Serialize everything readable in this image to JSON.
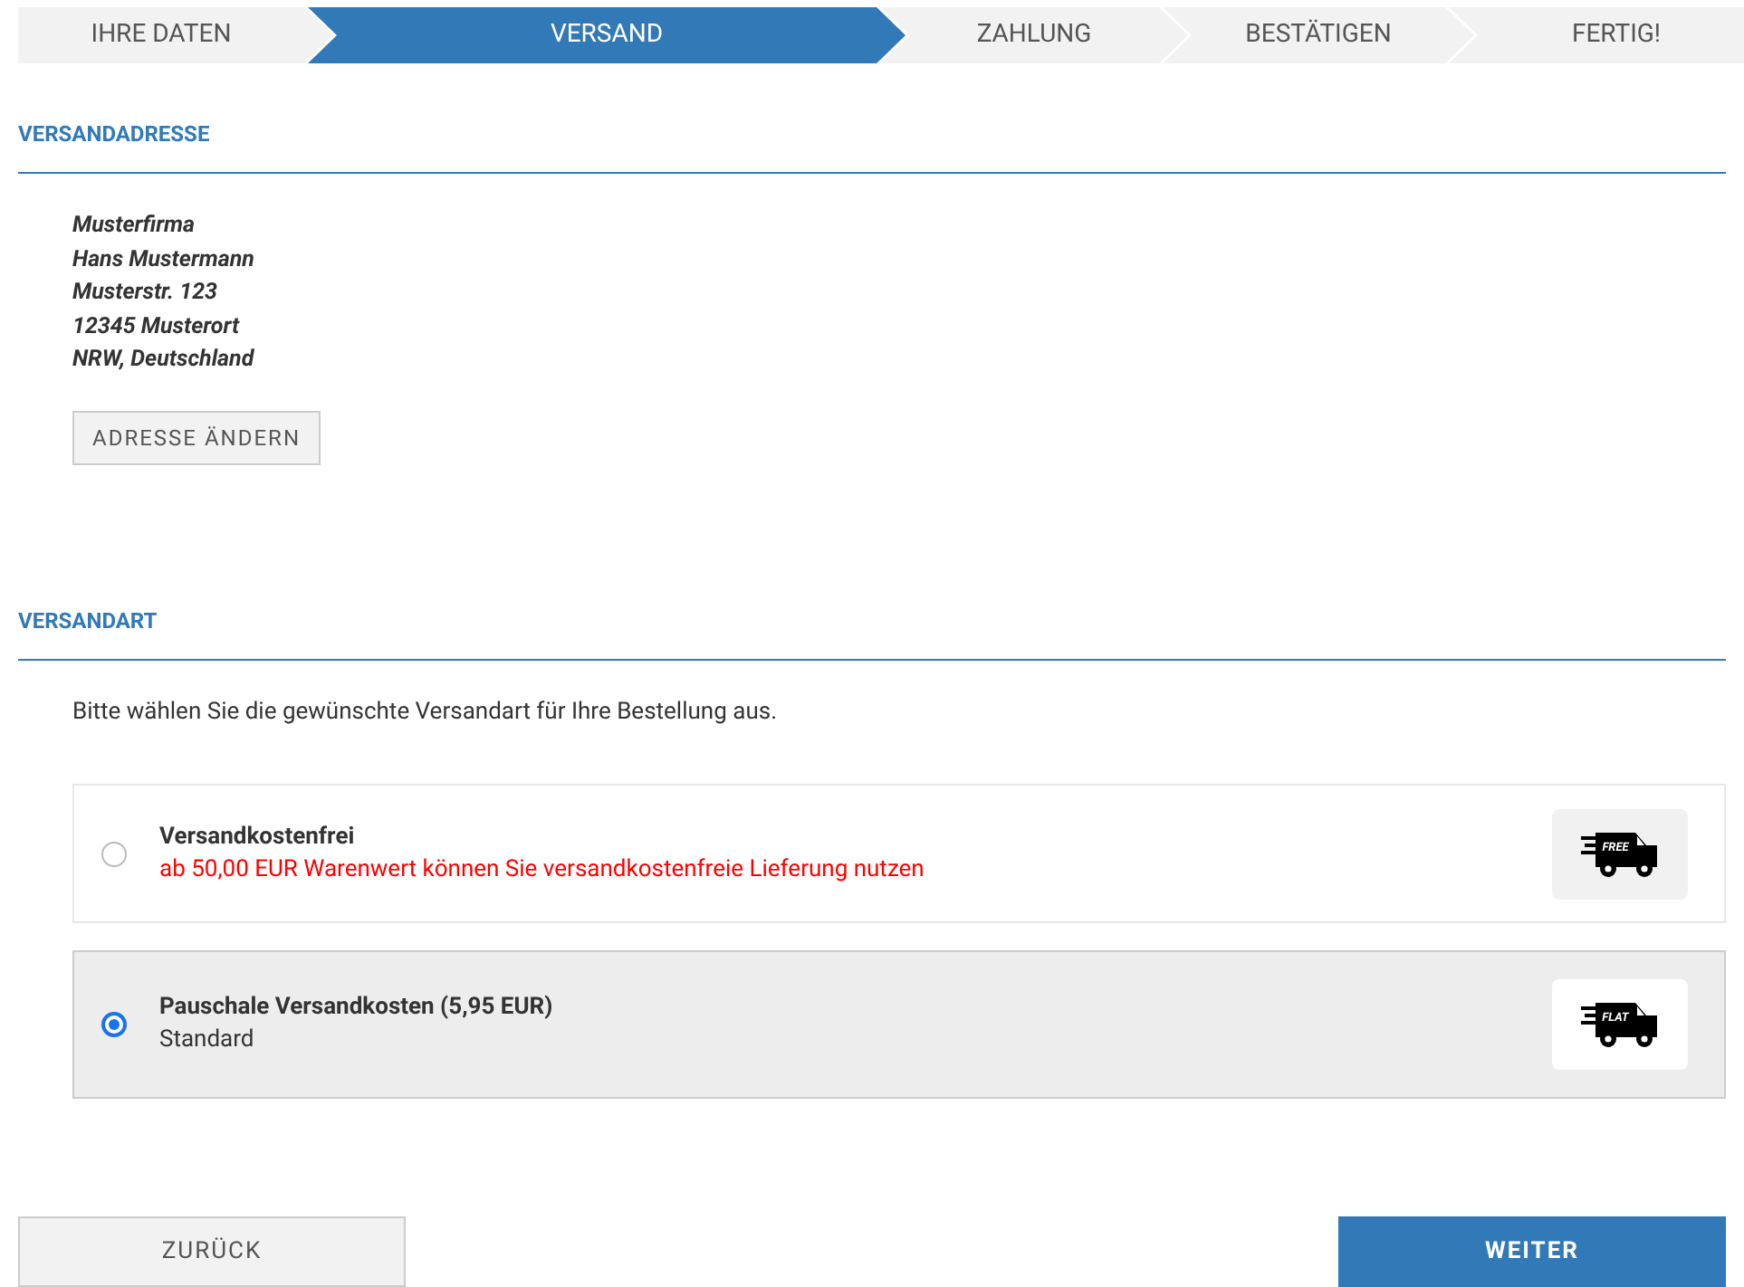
{
  "steps": [
    {
      "label": "IHRE DATEN",
      "selected": false
    },
    {
      "label": "VERSAND",
      "selected": true
    },
    {
      "label": "ZAHLUNG",
      "selected": false
    },
    {
      "label": "BESTÄTIGEN",
      "selected": false
    },
    {
      "label": "FERTIG!",
      "selected": false
    }
  ],
  "address_section": {
    "title": "VERSANDADRESSE",
    "lines": [
      "Musterfirma",
      "Hans Mustermann",
      "Musterstr. 123",
      "12345 Musterort",
      "NRW, Deutschland"
    ],
    "button": "ADRESSE ÄNDERN"
  },
  "shipping_section": {
    "title": "VERSANDART",
    "intro": "Bitte wählen Sie die gewünschte Versandart für Ihre Bestellung aus.",
    "options": [
      {
        "name": "Versandkostenfrei",
        "note": "ab 50,00 EUR Warenwert können Sie versandkostenfreie Lieferung nutzen",
        "icon_label": "FREE",
        "selected": false
      },
      {
        "name": "Pauschale Versandkosten (5,95 EUR)",
        "detail": "Standard",
        "icon_label": "FLAT",
        "selected": true
      }
    ]
  },
  "buttons": {
    "back": "ZURÜCK",
    "next": "WEITER"
  }
}
